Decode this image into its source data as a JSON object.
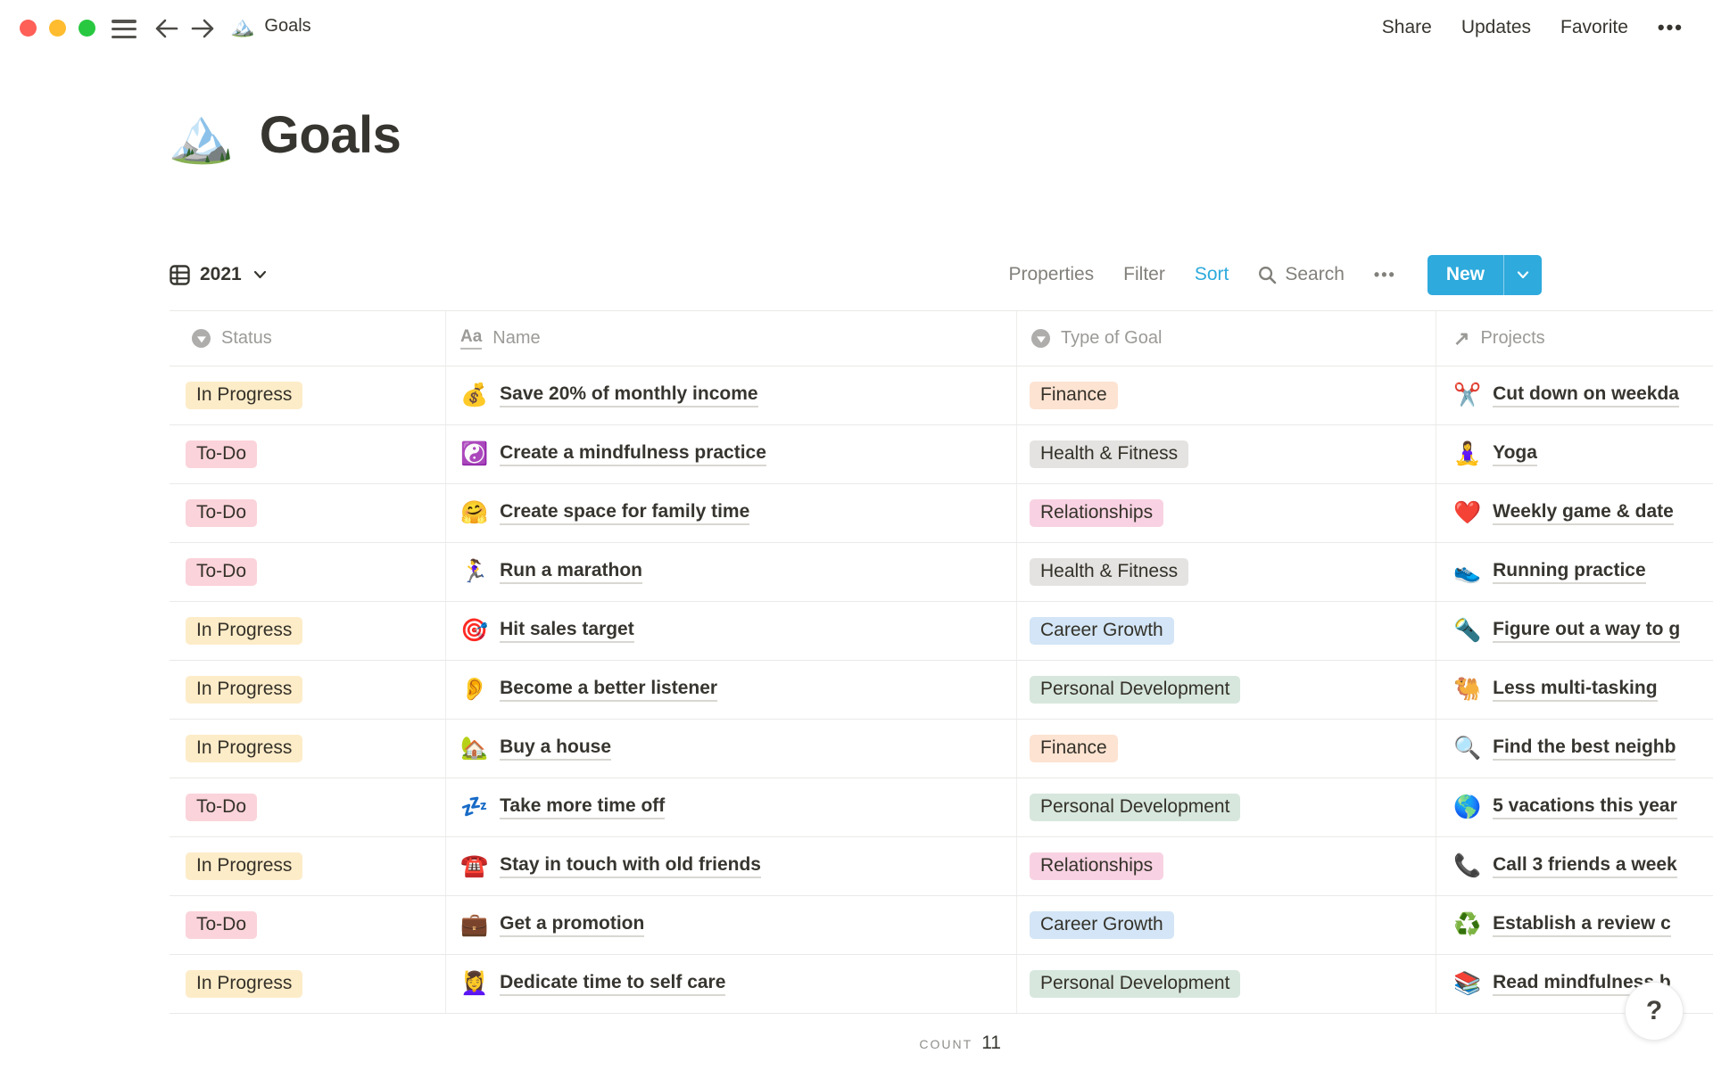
{
  "chrome": {
    "tab_icon": "🏔️",
    "tab_title": "Goals",
    "nav": {
      "share": "Share",
      "updates": "Updates",
      "favorite": "Favorite",
      "more": "•••"
    }
  },
  "page": {
    "icon": "🏔️",
    "title": "Goals"
  },
  "toolbar": {
    "view_label": "2021",
    "properties": "Properties",
    "filter": "Filter",
    "sort": "Sort",
    "search": "Search",
    "more": "•••",
    "new_label": "New"
  },
  "table": {
    "columns": [
      {
        "label": "Status"
      },
      {
        "label": "Name"
      },
      {
        "label": "Type of Goal"
      },
      {
        "label": "Projects"
      }
    ],
    "rows": [
      {
        "status": "In Progress",
        "name_icon": "💰",
        "name": "Save 20% of monthly income",
        "type": "Finance",
        "project_icon": "✂️",
        "project": "Cut down on weekda"
      },
      {
        "status": "To-Do",
        "name_icon": "☯️",
        "name": "Create a mindfulness practice",
        "type": "Health & Fitness",
        "project_icon": "🧘‍♀️",
        "project": "Yoga"
      },
      {
        "status": "To-Do",
        "name_icon": "🤗",
        "name": "Create space for family time",
        "type": "Relationships",
        "project_icon": "❤️",
        "project": "Weekly game & date"
      },
      {
        "status": "To-Do",
        "name_icon": "🏃‍♀️",
        "name": "Run a marathon",
        "type": "Health & Fitness",
        "project_icon": "👟",
        "project": "Running practice"
      },
      {
        "status": "In Progress",
        "name_icon": "🎯",
        "name": "Hit sales target",
        "type": "Career Growth",
        "project_icon": "🔦",
        "project": "Figure out a way to g"
      },
      {
        "status": "In Progress",
        "name_icon": "👂",
        "name": "Become a better listener",
        "type": "Personal Development",
        "project_icon": "🐫",
        "project": "Less multi-tasking"
      },
      {
        "status": "In Progress",
        "name_icon": "🏡",
        "name": "Buy a house",
        "type": "Finance",
        "project_icon": "🔍",
        "project": "Find the best neighb"
      },
      {
        "status": "To-Do",
        "name_icon": "💤",
        "name": "Take more time off",
        "type": "Personal Development",
        "project_icon": "🌎",
        "project": "5 vacations this year"
      },
      {
        "status": "In Progress",
        "name_icon": "☎️",
        "name": "Stay in touch with old friends",
        "type": "Relationships",
        "project_icon": "📞",
        "project": "Call 3 friends a week"
      },
      {
        "status": "To-Do",
        "name_icon": "💼",
        "name": "Get a promotion",
        "type": "Career Growth",
        "project_icon": "♻️",
        "project": "Establish a review c"
      },
      {
        "status": "In Progress",
        "name_icon": "💆‍♀️",
        "name": "Dedicate time to self care",
        "type": "Personal Development",
        "project_icon": "📚",
        "project": "Read mindfulness b"
      }
    ]
  },
  "footer": {
    "count_label": "COUNT",
    "count_value": "11"
  },
  "help": {
    "label": "?"
  },
  "colors": {
    "accent_blue": "#2eaadc",
    "traffic": [
      "#fe5f57",
      "#febc2e",
      "#28c840"
    ],
    "status": {
      "In Progress": "#fdecc8",
      "To-Do": "#fbd3da"
    },
    "type": {
      "Finance": "#fde3d2",
      "Health & Fitness": "#e4e3e1",
      "Relationships": "#f8d2e2",
      "Career Growth": "#d3e5f6",
      "Personal Development": "#d7e7dd"
    }
  }
}
